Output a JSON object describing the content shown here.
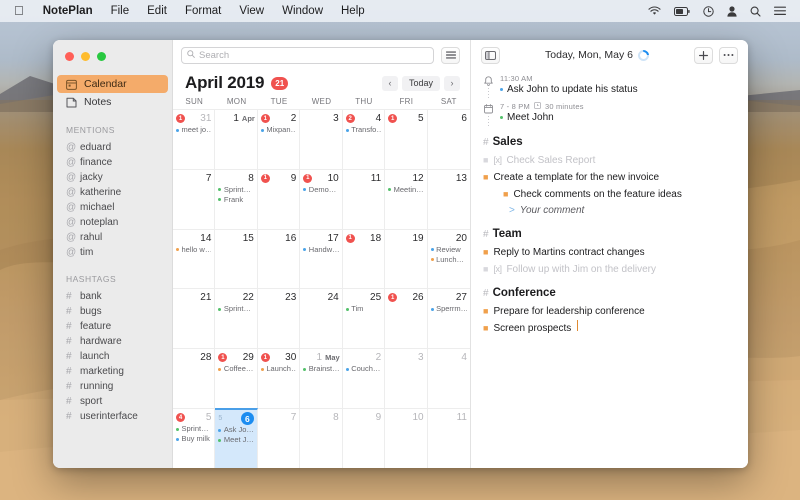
{
  "menubar": {
    "apple": "",
    "items": [
      "NotePlan",
      "File",
      "Edit",
      "Format",
      "View",
      "Window",
      "Help"
    ],
    "status_icons": [
      "wifi-icon",
      "battery-icon",
      "clock-icon",
      "user-icon",
      "search-icon",
      "control-center-icon"
    ]
  },
  "sidebar": {
    "nav": [
      {
        "label": "Calendar",
        "icon": "calendar-icon",
        "active": true
      },
      {
        "label": "Notes",
        "icon": "note-icon",
        "active": false
      }
    ],
    "mentions_header": "MENTIONS",
    "mentions": [
      "eduard",
      "finance",
      "jacky",
      "katherine",
      "michael",
      "noteplan",
      "rahul",
      "tim"
    ],
    "hashtags_header": "HASHTAGS",
    "hashtags": [
      "bank",
      "bugs",
      "feature",
      "hardware",
      "launch",
      "marketing",
      "running",
      "sport",
      "userinterface"
    ]
  },
  "calendar": {
    "search_placeholder": "Search",
    "list_button": "list-view-button",
    "month_title": "April 2019",
    "month_badge": "21",
    "prev_label": "‹",
    "today_label": "Today",
    "next_label": "›",
    "dow": [
      "SUN",
      "MON",
      "TUE",
      "WED",
      "THU",
      "FRI",
      "SAT"
    ],
    "weeks": [
      [
        {
          "num": "31",
          "other": true,
          "badge": "1",
          "events": [
            {
              "text": "meet jo…",
              "color": "#4aa3e8"
            }
          ]
        },
        {
          "num": "1",
          "month": "Apr",
          "events": []
        },
        {
          "num": "2",
          "badge": "1",
          "events": [
            {
              "text": "Mixpan…",
              "color": "#4aa3e8"
            }
          ]
        },
        {
          "num": "3",
          "events": []
        },
        {
          "num": "4",
          "badge": "2",
          "events": [
            {
              "text": "Transfo…",
              "color": "#4aa3e8"
            }
          ]
        },
        {
          "num": "5",
          "badge": "1",
          "events": []
        },
        {
          "num": "6",
          "events": []
        }
      ],
      [
        {
          "num": "7",
          "events": []
        },
        {
          "num": "8",
          "events": [
            {
              "text": "Sprint…",
              "color": "#53c06a"
            },
            {
              "text": "Frank",
              "color": "#53c06a"
            }
          ]
        },
        {
          "num": "9",
          "badge": "1",
          "events": []
        },
        {
          "num": "10",
          "badge": "1",
          "events": [
            {
              "text": "Demo…",
              "color": "#4aa3e8"
            }
          ]
        },
        {
          "num": "11",
          "events": []
        },
        {
          "num": "12",
          "events": [
            {
              "text": "Meetin…",
              "color": "#53c06a"
            }
          ]
        },
        {
          "num": "13",
          "events": []
        }
      ],
      [
        {
          "num": "14",
          "events": [
            {
              "text": "hello w…",
              "color": "#f0a04b"
            }
          ]
        },
        {
          "num": "15",
          "events": []
        },
        {
          "num": "16",
          "events": []
        },
        {
          "num": "17",
          "events": [
            {
              "text": "Handw…",
              "color": "#4aa3e8"
            }
          ]
        },
        {
          "num": "18",
          "badge": "1",
          "events": []
        },
        {
          "num": "19",
          "events": []
        },
        {
          "num": "20",
          "events": [
            {
              "text": "Review",
              "color": "#4aa3e8"
            },
            {
              "text": "Lunch…",
              "color": "#f0a04b"
            }
          ]
        }
      ],
      [
        {
          "num": "21",
          "events": []
        },
        {
          "num": "22",
          "events": [
            {
              "text": "Sprint…",
              "color": "#53c06a"
            }
          ]
        },
        {
          "num": "23",
          "events": []
        },
        {
          "num": "24",
          "events": []
        },
        {
          "num": "25",
          "events": [
            {
              "text": "Tim",
              "color": "#53c06a"
            }
          ]
        },
        {
          "num": "26",
          "badge": "1",
          "events": []
        },
        {
          "num": "27",
          "events": [
            {
              "text": "Sperrm…",
              "color": "#4aa3e8"
            }
          ]
        }
      ],
      [
        {
          "num": "28",
          "events": []
        },
        {
          "num": "29",
          "badge": "1",
          "events": [
            {
              "text": "Coffee…",
              "color": "#f0a04b"
            }
          ]
        },
        {
          "num": "30",
          "badge": "1",
          "events": [
            {
              "text": "Launch…",
              "color": "#f0a04b"
            }
          ]
        },
        {
          "num": "1",
          "month": "May",
          "other": true,
          "events": [
            {
              "text": "Brainst…",
              "color": "#53c06a"
            }
          ]
        },
        {
          "num": "2",
          "other": true,
          "events": [
            {
              "text": "Couch…",
              "color": "#4aa3e8"
            }
          ]
        },
        {
          "num": "3",
          "other": true,
          "events": []
        },
        {
          "num": "4",
          "other": true,
          "events": []
        }
      ],
      [
        {
          "num": "5",
          "other": true,
          "badge": "4",
          "events": [
            {
              "text": "Sprint…",
              "color": "#53c06a"
            },
            {
              "text": "Buy milk",
              "color": "#4aa3e8"
            }
          ]
        },
        {
          "num": "6",
          "other": true,
          "selected": true,
          "ghost": "5",
          "events": [
            {
              "text": "Ask Jo…",
              "color": "#4aa3e8"
            },
            {
              "text": "Meet J…",
              "color": "#53c06a"
            }
          ]
        },
        {
          "num": "7",
          "other": true,
          "events": []
        },
        {
          "num": "8",
          "other": true,
          "events": []
        },
        {
          "num": "9",
          "other": true,
          "events": []
        },
        {
          "num": "10",
          "other": true,
          "events": []
        },
        {
          "num": "11",
          "other": true,
          "events": []
        }
      ]
    ]
  },
  "notes": {
    "sidebar_toggle": "split-view-button",
    "title": "Today, Mon, May 6",
    "sync_status": "sync-spinner",
    "add_label": "+",
    "more_label": "···",
    "events": [
      {
        "icon": "bell-icon",
        "time": "11:30 AM",
        "duration": "",
        "title": "Ask John to update his status",
        "color": "#4aa3e8"
      },
      {
        "icon": "calendar-icon",
        "time": "7 - 8 PM",
        "duration": "30 minutes",
        "title": "Meet John",
        "color": "#53c06a"
      }
    ],
    "sections": [
      {
        "heading": "Sales",
        "items": [
          {
            "text": "Check Sales Report",
            "done": true,
            "indent": 0,
            "type": "todo"
          },
          {
            "text": "Create a template for the new invoice",
            "done": false,
            "indent": 0,
            "type": "todo"
          },
          {
            "text": "Check comments on the feature ideas",
            "done": false,
            "indent": 1,
            "type": "todo"
          },
          {
            "text": "Your comment",
            "done": false,
            "indent": 1,
            "type": "quote"
          }
        ]
      },
      {
        "heading": "Team",
        "items": [
          {
            "text": "Reply to Martins contract changes",
            "done": false,
            "indent": 0,
            "type": "todo"
          },
          {
            "text": "Follow up with Jim on the delivery",
            "done": true,
            "indent": 0,
            "type": "todo"
          }
        ]
      },
      {
        "heading": "Conference",
        "items": [
          {
            "text": "Prepare for leadership conference",
            "done": false,
            "indent": 0,
            "type": "todo"
          },
          {
            "text": "Screen prospects",
            "done": false,
            "indent": 0,
            "type": "todo",
            "caret": true
          }
        ]
      }
    ]
  },
  "colors": {
    "accent_orange": "#f4ab6a",
    "badge_red": "#f0524f",
    "selection_blue": "#1b8cf0",
    "event_blue": "#4aa3e8",
    "event_green": "#53c06a",
    "event_orange": "#f0a04b"
  }
}
